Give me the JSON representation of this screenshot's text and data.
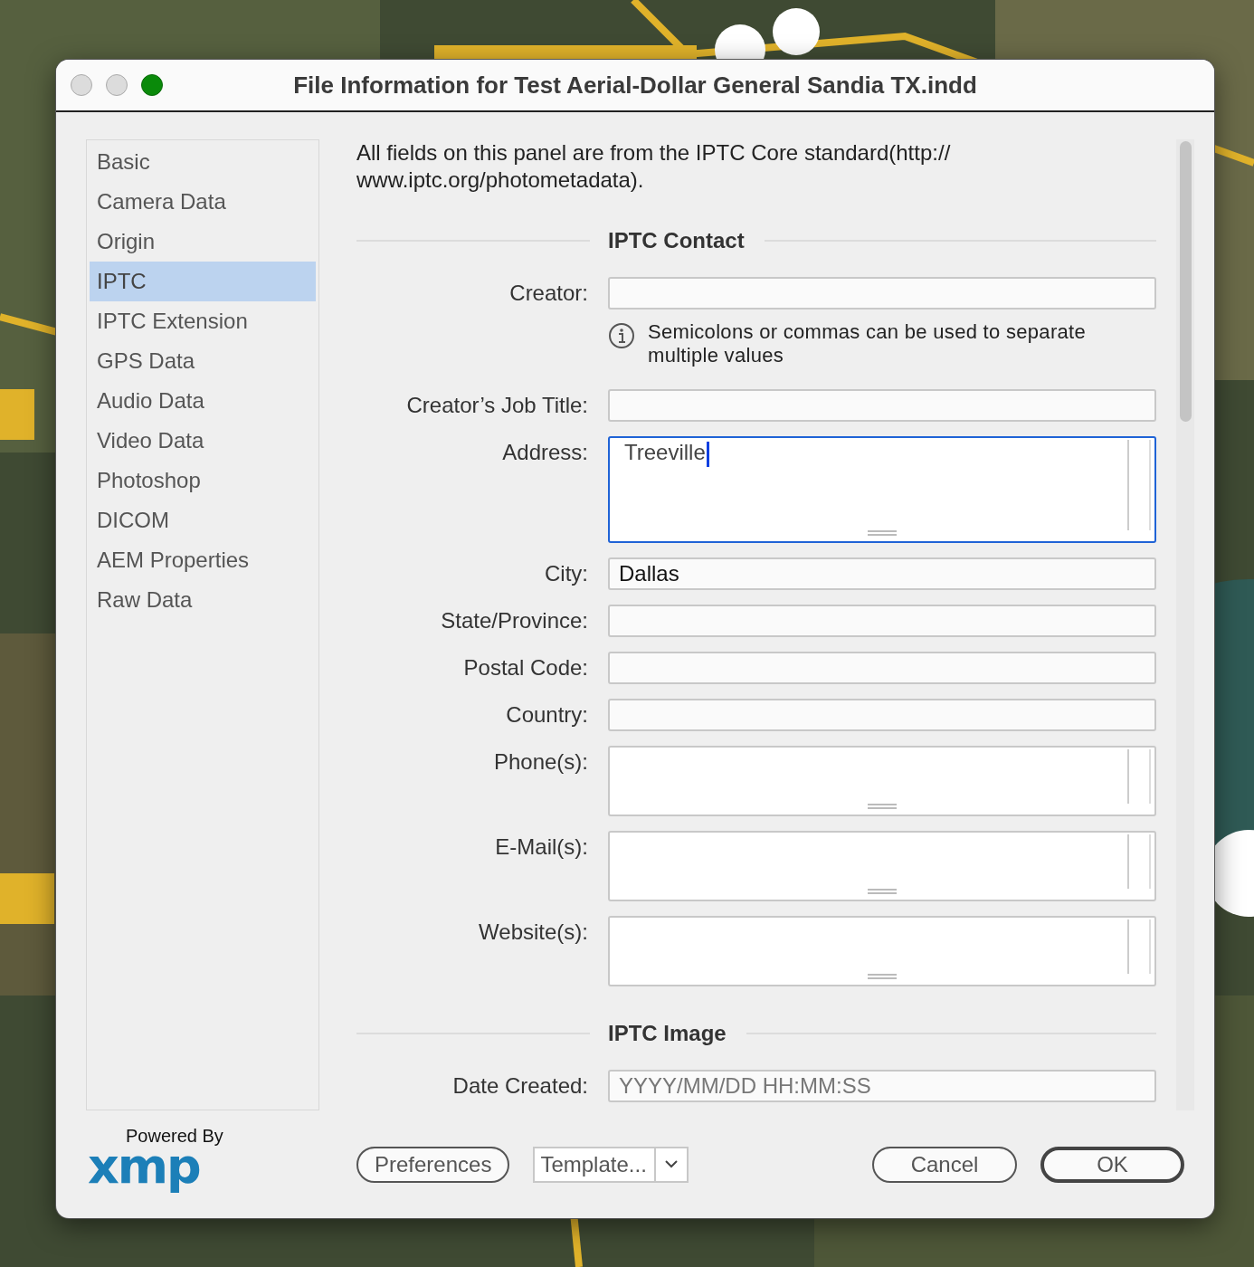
{
  "window": {
    "title": "File Information for Test Aerial-Dollar General Sandia TX.indd"
  },
  "sidebar": {
    "items": [
      {
        "label": "Basic",
        "selected": false
      },
      {
        "label": "Camera Data",
        "selected": false
      },
      {
        "label": "Origin",
        "selected": false
      },
      {
        "label": "IPTC",
        "selected": true
      },
      {
        "label": "IPTC Extension",
        "selected": false
      },
      {
        "label": "GPS Data",
        "selected": false
      },
      {
        "label": "Audio Data",
        "selected": false
      },
      {
        "label": "Video Data",
        "selected": false
      },
      {
        "label": "Photoshop",
        "selected": false
      },
      {
        "label": "DICOM",
        "selected": false
      },
      {
        "label": "AEM Properties",
        "selected": false
      },
      {
        "label": "Raw Data",
        "selected": false
      }
    ]
  },
  "panel": {
    "intro": "All fields on this panel are from the IPTC Core standard(http:// www.iptc.org/photometadata).",
    "sections": [
      {
        "heading": "IPTC Contact",
        "fields": [
          {
            "label": "Creator:",
            "kind": "line",
            "focused": false,
            "hint": "Semicolons or commas can be used to separate multiple values"
          },
          {
            "label": "Creator’s Job Title:",
            "kind": "line",
            "focused": false
          },
          {
            "label": "Address:",
            "kind": "tallbox",
            "focused": true,
            "value": "Treeville"
          },
          {
            "label": "City:",
            "kind": "line",
            "focused": false,
            "value": "Dallas"
          },
          {
            "label": "State/Province:",
            "kind": "line",
            "focused": false
          },
          {
            "label": "Postal Code:",
            "kind": "line",
            "focused": false
          },
          {
            "label": "Country:",
            "kind": "line",
            "focused": false
          },
          {
            "label": "Phone(s):",
            "kind": "box",
            "focused": false
          },
          {
            "label": "E-Mail(s):",
            "kind": "box",
            "focused": false
          },
          {
            "label": "Website(s):",
            "kind": "box",
            "focused": false
          }
        ]
      },
      {
        "heading": "IPTC Image",
        "fields": [
          {
            "label": "Date Created:",
            "kind": "line",
            "focused": false,
            "placeholder": "YYYY/MM/DD HH:MM:SS"
          }
        ]
      }
    ]
  },
  "footer": {
    "logo": {
      "caption": "Powered By",
      "mark": "xmp"
    },
    "buttons": [
      {
        "label": "Preferences",
        "kind": "push"
      },
      {
        "label": "Template...",
        "kind": "dropdown"
      },
      {
        "label": "Cancel",
        "kind": "push"
      },
      {
        "label": "OK",
        "kind": "default"
      }
    ]
  }
}
